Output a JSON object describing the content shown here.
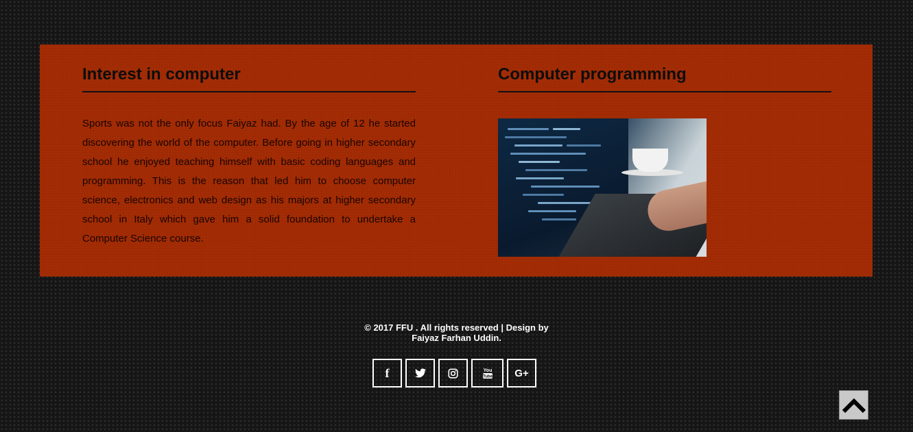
{
  "left_section": {
    "title": "Interest in computer",
    "body": "Sports was not the only focus Faiyaz had. By the age of 12 he started discovering the world of the computer. Before going in higher secondary school he enjoyed teaching himself with basic coding languages and programming. This is the reason that led him to choose computer science, electronics and web design as his majors at higher secondary school in Italy which gave him a solid foundation to undertake a Computer Science course."
  },
  "right_section": {
    "title": "Computer programming",
    "image": "laptop-coding-photo"
  },
  "footer": {
    "copyright_line1": "© 2017 FFU . All rights reserved | Design by",
    "copyright_line2": "Faiyaz Farhan Uddin.",
    "social": [
      {
        "icon": "facebook-icon",
        "glyph": "f"
      },
      {
        "icon": "twitter-icon",
        "glyph": ""
      },
      {
        "icon": "instagram-icon",
        "glyph": ""
      },
      {
        "icon": "youtube-icon",
        "glyph": ""
      },
      {
        "icon": "google-plus-icon",
        "glyph": "G+"
      }
    ]
  },
  "colors": {
    "panel": "#a32c05",
    "background": "#141414",
    "footer_text": "#ffffff"
  },
  "scroll_top": {
    "icon": "chevron-up-icon"
  }
}
